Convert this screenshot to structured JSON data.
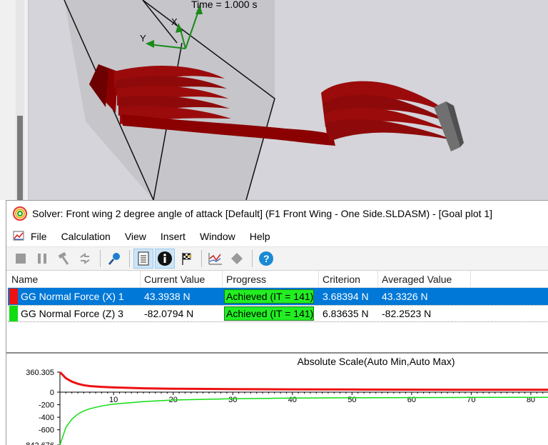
{
  "viewport": {
    "time_label": "Time = 1.000 s",
    "axis_x_label": "X",
    "axis_y_label": "Y"
  },
  "solver": {
    "title": "Solver: Front wing 2 degree angle of attack [Default] (F1 Front Wing - One Side.SLDASM) - [Goal plot 1]",
    "menu": [
      "File",
      "Calculation",
      "View",
      "Insert",
      "Window",
      "Help"
    ],
    "table": {
      "columns": [
        "Name",
        "Current Value",
        "Progress",
        "Criterion",
        "Averaged Value"
      ],
      "rows": [
        {
          "name": "GG Normal Force (X) 1",
          "current_value": "43.3938 N",
          "progress": "Achieved (IT = 141)",
          "criterion": "3.68394 N",
          "averaged_value": "43.3326 N",
          "color": "#ee1111"
        },
        {
          "name": "GG Normal Force (Z) 3",
          "current_value": "-82.0794 N",
          "progress": "Achieved (IT = 141)",
          "criterion": "6.83635 N",
          "averaged_value": "-82.2523 N",
          "color": "#11dd11"
        }
      ]
    }
  },
  "chart_data": {
    "type": "line",
    "title": "Absolute Scale(Auto Min,Auto Max)",
    "x_ticks": [
      "10",
      "20",
      "30",
      "40",
      "50",
      "60",
      "70",
      "80"
    ],
    "y_ticks": [
      "360.305",
      "0",
      "-200",
      "-400",
      "-600",
      "-842.676"
    ],
    "xlim": [
      1,
      83
    ],
    "ylim": [
      -842.676,
      360.305
    ],
    "series": [
      {
        "color": "#ee1111",
        "x": [
          1,
          2,
          3,
          4,
          5,
          6,
          8,
          10,
          15,
          20,
          30,
          40,
          50,
          60,
          70,
          80,
          83
        ],
        "y": [
          360.305,
          250,
          190,
          150,
          125,
          110,
          95,
          85,
          70,
          62,
          55,
          50,
          47,
          45,
          44,
          43.5,
          43.4
        ]
      },
      {
        "color": "#11dd11",
        "x": [
          1,
          2,
          3,
          4,
          5,
          6,
          8,
          10,
          15,
          20,
          30,
          40,
          50,
          60,
          70,
          80,
          83
        ],
        "y": [
          -842.676,
          -560,
          -430,
          -350,
          -300,
          -265,
          -220,
          -190,
          -150,
          -125,
          -105,
          -95,
          -90,
          -86,
          -84,
          -82.2,
          -82.1
        ]
      }
    ]
  }
}
